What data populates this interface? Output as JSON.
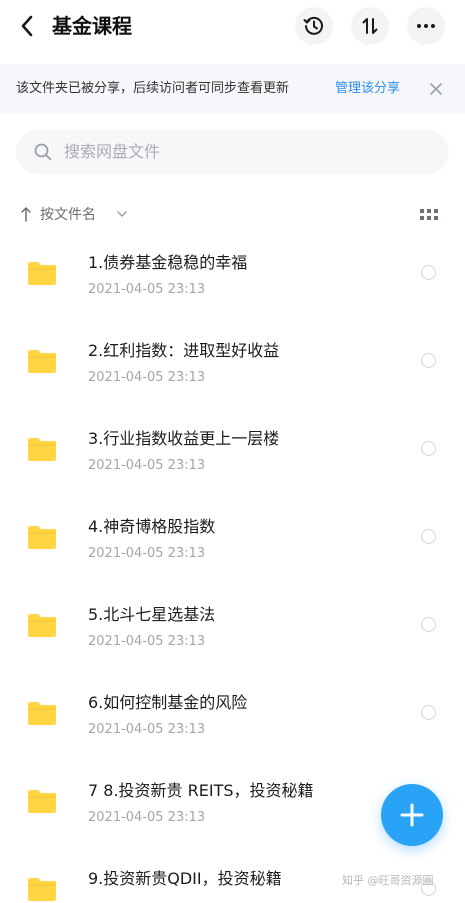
{
  "header": {
    "title": "基金课程",
    "back_icon": "chevron-left-icon",
    "actions": [
      {
        "icon": "history-clock-icon"
      },
      {
        "icon": "sort-updown-icon"
      },
      {
        "icon": "more-dots-icon"
      }
    ]
  },
  "share_banner": {
    "text": "该文件夹已被分享，后续访问者可同步查看更新",
    "link": "管理该分享",
    "close_icon": "close-icon"
  },
  "search": {
    "placeholder": "搜索网盘文件",
    "icon": "search-icon"
  },
  "sort_bar": {
    "label": "按文件名",
    "arrow_icon": "up-arrow-icon",
    "chevron_icon": "chevron-down-icon",
    "view_icon": "grid-view-icon"
  },
  "files": [
    {
      "name": "1.债券基金稳稳的幸福",
      "date": "2021-04-05  23:13"
    },
    {
      "name": "2.红利指数：进取型好收益",
      "date": "2021-04-05  23:13"
    },
    {
      "name": "3.行业指数收益更上一层楼",
      "date": "2021-04-05  23:13"
    },
    {
      "name": "4.神奇博格股指数",
      "date": "2021-04-05  23:13"
    },
    {
      "name": "5.北斗七星选基法",
      "date": "2021-04-05  23:13"
    },
    {
      "name": "6.如何控制基金的风险",
      "date": "2021-04-05  23:13"
    },
    {
      "name": "7   8.投资新贵 REITS，投资秘籍",
      "date": "2021-04-05  23:13"
    },
    {
      "name": "9.投资新贵QDII，投资秘籍",
      "date": ""
    }
  ],
  "fab": {
    "icon": "plus-icon"
  },
  "watermark": "知乎 @旺哥资源圈",
  "colors": {
    "accent": "#2b8ef0",
    "fab": "#28a3f5",
    "folder": "#ffd543",
    "banner_bg": "#f5f7fb"
  }
}
